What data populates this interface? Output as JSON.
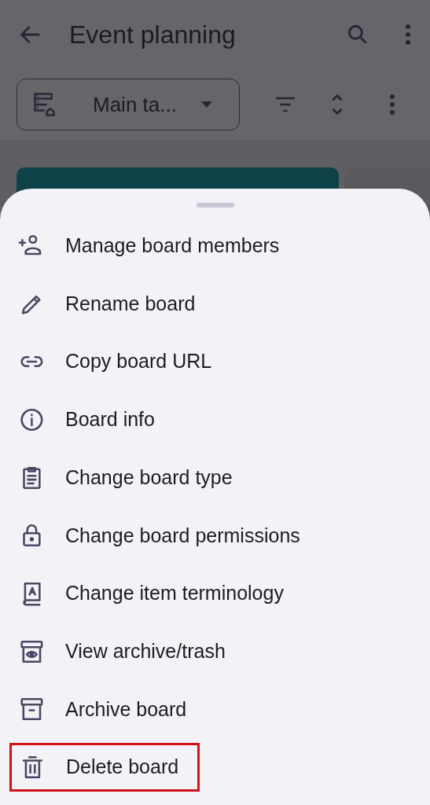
{
  "app_bar": {
    "title": "Event planning"
  },
  "toolbar": {
    "view_selector": "Main ta..."
  },
  "sheet": {
    "items": [
      {
        "label": "Manage board members",
        "highlighted": false
      },
      {
        "label": "Rename board",
        "highlighted": false
      },
      {
        "label": "Copy board URL",
        "highlighted": false
      },
      {
        "label": "Board info",
        "highlighted": false
      },
      {
        "label": "Change board type",
        "highlighted": false
      },
      {
        "label": "Change board permissions",
        "highlighted": false
      },
      {
        "label": "Change item terminology",
        "highlighted": false
      },
      {
        "label": "View archive/trash",
        "highlighted": false
      },
      {
        "label": "Archive board",
        "highlighted": false
      },
      {
        "label": "Delete board",
        "highlighted": true
      }
    ]
  }
}
